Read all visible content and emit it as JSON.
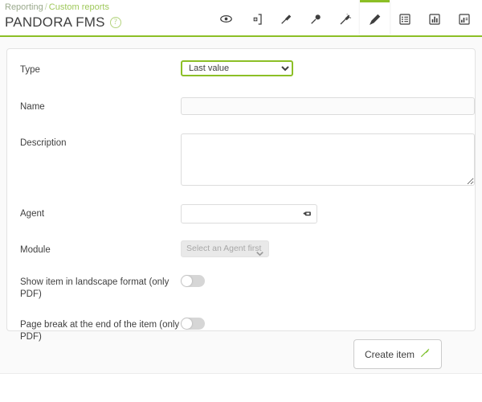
{
  "header": {
    "breadcrumb": {
      "parent": "Reporting",
      "separator": "/",
      "current": "Custom reports"
    },
    "title": "PANDORA FMS",
    "help_icon": "help-circle-icon",
    "accent_color": "#8cbf26",
    "tabs": [
      {
        "name": "eye-icon",
        "label": "View report",
        "active": false
      },
      {
        "name": "add-box-icon",
        "label": "Create new report",
        "active": false
      },
      {
        "name": "pin-icon",
        "label": "Item editor",
        "active": false
      },
      {
        "name": "thumbtack-icon",
        "label": "Global item",
        "active": false
      },
      {
        "name": "magic-wand-icon",
        "label": "Wizard",
        "active": false
      },
      {
        "name": "pencil-icon",
        "label": "Edit report",
        "active": true
      },
      {
        "name": "list-icon",
        "label": "List items",
        "active": false
      },
      {
        "name": "bar-chart-icon",
        "label": "Graph",
        "active": false
      },
      {
        "name": "chart-legend-icon",
        "label": "Advanced options",
        "active": false
      }
    ]
  },
  "form": {
    "type": {
      "label": "Type",
      "value": "Last value",
      "options": [
        "Last value"
      ]
    },
    "name": {
      "label": "Name",
      "value": "",
      "placeholder": ""
    },
    "description": {
      "label": "Description",
      "value": "",
      "placeholder": ""
    },
    "agent": {
      "label": "Agent",
      "value": "",
      "placeholder": "",
      "icon": "agent-picker-icon"
    },
    "module": {
      "label": "Module",
      "value": "Select an Agent first",
      "disabled": true
    },
    "landscape": {
      "label": "Show item in landscape format (only PDF)",
      "state": "off"
    },
    "page_break": {
      "label": "Page break at the end of the item (only PDF)",
      "state": "off"
    }
  },
  "footer": {
    "create_label": "Create item",
    "create_icon": "wand-icon"
  }
}
